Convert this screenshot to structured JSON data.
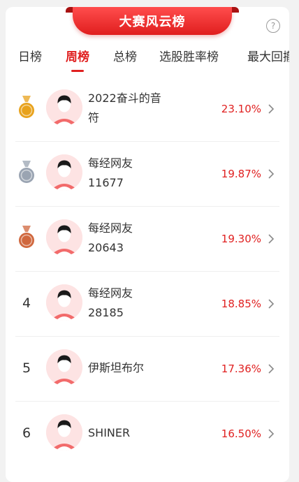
{
  "header": {
    "title": "大赛风云榜",
    "help_icon": "?"
  },
  "tabs": [
    {
      "label": "日榜",
      "active": false
    },
    {
      "label": "周榜",
      "active": true
    },
    {
      "label": "总榜",
      "active": false
    },
    {
      "label": "选股胜率榜",
      "active": false
    },
    {
      "label": "最大回撤",
      "active": false
    }
  ],
  "rankings": [
    {
      "rank": "1",
      "medal": "gold",
      "name_line1": "2022奋斗的音",
      "name_line2": "符",
      "pct": "23.10%"
    },
    {
      "rank": "2",
      "medal": "silver",
      "name_line1": "每经网友",
      "name_line2": "11677",
      "pct": "19.87%"
    },
    {
      "rank": "3",
      "medal": "bronze",
      "name_line1": "每经网友",
      "name_line2": "20643",
      "pct": "19.30%"
    },
    {
      "rank": "4",
      "medal": "",
      "name_line1": "每经网友",
      "name_line2": "28185",
      "pct": "18.85%"
    },
    {
      "rank": "5",
      "medal": "",
      "name_line1": "伊斯坦布尔",
      "name_line2": "",
      "pct": "17.36%"
    },
    {
      "rank": "6",
      "medal": "",
      "name_line1": "SHINER",
      "name_line2": "",
      "pct": "16.50%"
    }
  ],
  "colors": {
    "accent": "#e02020",
    "gold": "#e8a21c",
    "silver": "#9aa4b2",
    "bronze": "#d0673d",
    "avatar_bg": "#fde3e3"
  }
}
